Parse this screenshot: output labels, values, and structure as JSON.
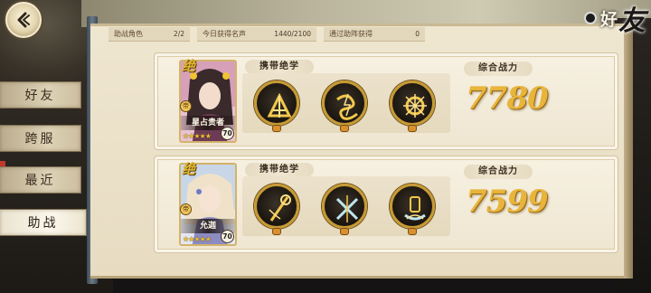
{
  "header": {
    "title_part1": "好",
    "title_part2": "友"
  },
  "stats": {
    "assist_heroes_label": "助战角色",
    "assist_heroes_value": "2/2",
    "reputation_label": "今日获得名声",
    "reputation_value": "1440/2100",
    "assist_reward_label": "通过助阵获得",
    "assist_reward_value": "0"
  },
  "tabs": [
    {
      "label": "好友",
      "active": false
    },
    {
      "label": "跨服",
      "active": false
    },
    {
      "label": "最近",
      "active": false
    },
    {
      "label": "助战",
      "active": true
    }
  ],
  "cards": [
    {
      "badge": "绝",
      "rank_tag": "帝",
      "hero_name": "星占贵者",
      "stars": "★★★★★",
      "level": "70",
      "skills_label": "携带绝学",
      "power_label": "综合战力",
      "power": "7780",
      "skill_icons": [
        "sword-burst-icon",
        "lightning-serpent-icon",
        "golden-orb-icon"
      ]
    },
    {
      "badge": "绝",
      "rank_tag": "帝",
      "hero_name": "允迦",
      "stars": "★★★★★",
      "level": "70",
      "skills_label": "携带绝学",
      "power_label": "综合战力",
      "power": "7599",
      "skill_icons": [
        "staff-strike-icon",
        "crossed-blades-icon",
        "scroll-wave-icon"
      ]
    }
  ],
  "colors": {
    "panel": "#efe6d0",
    "power_gold": "#e8b53c",
    "skill_ring": "#c69a35",
    "tab_active": "#fbf7ec"
  }
}
